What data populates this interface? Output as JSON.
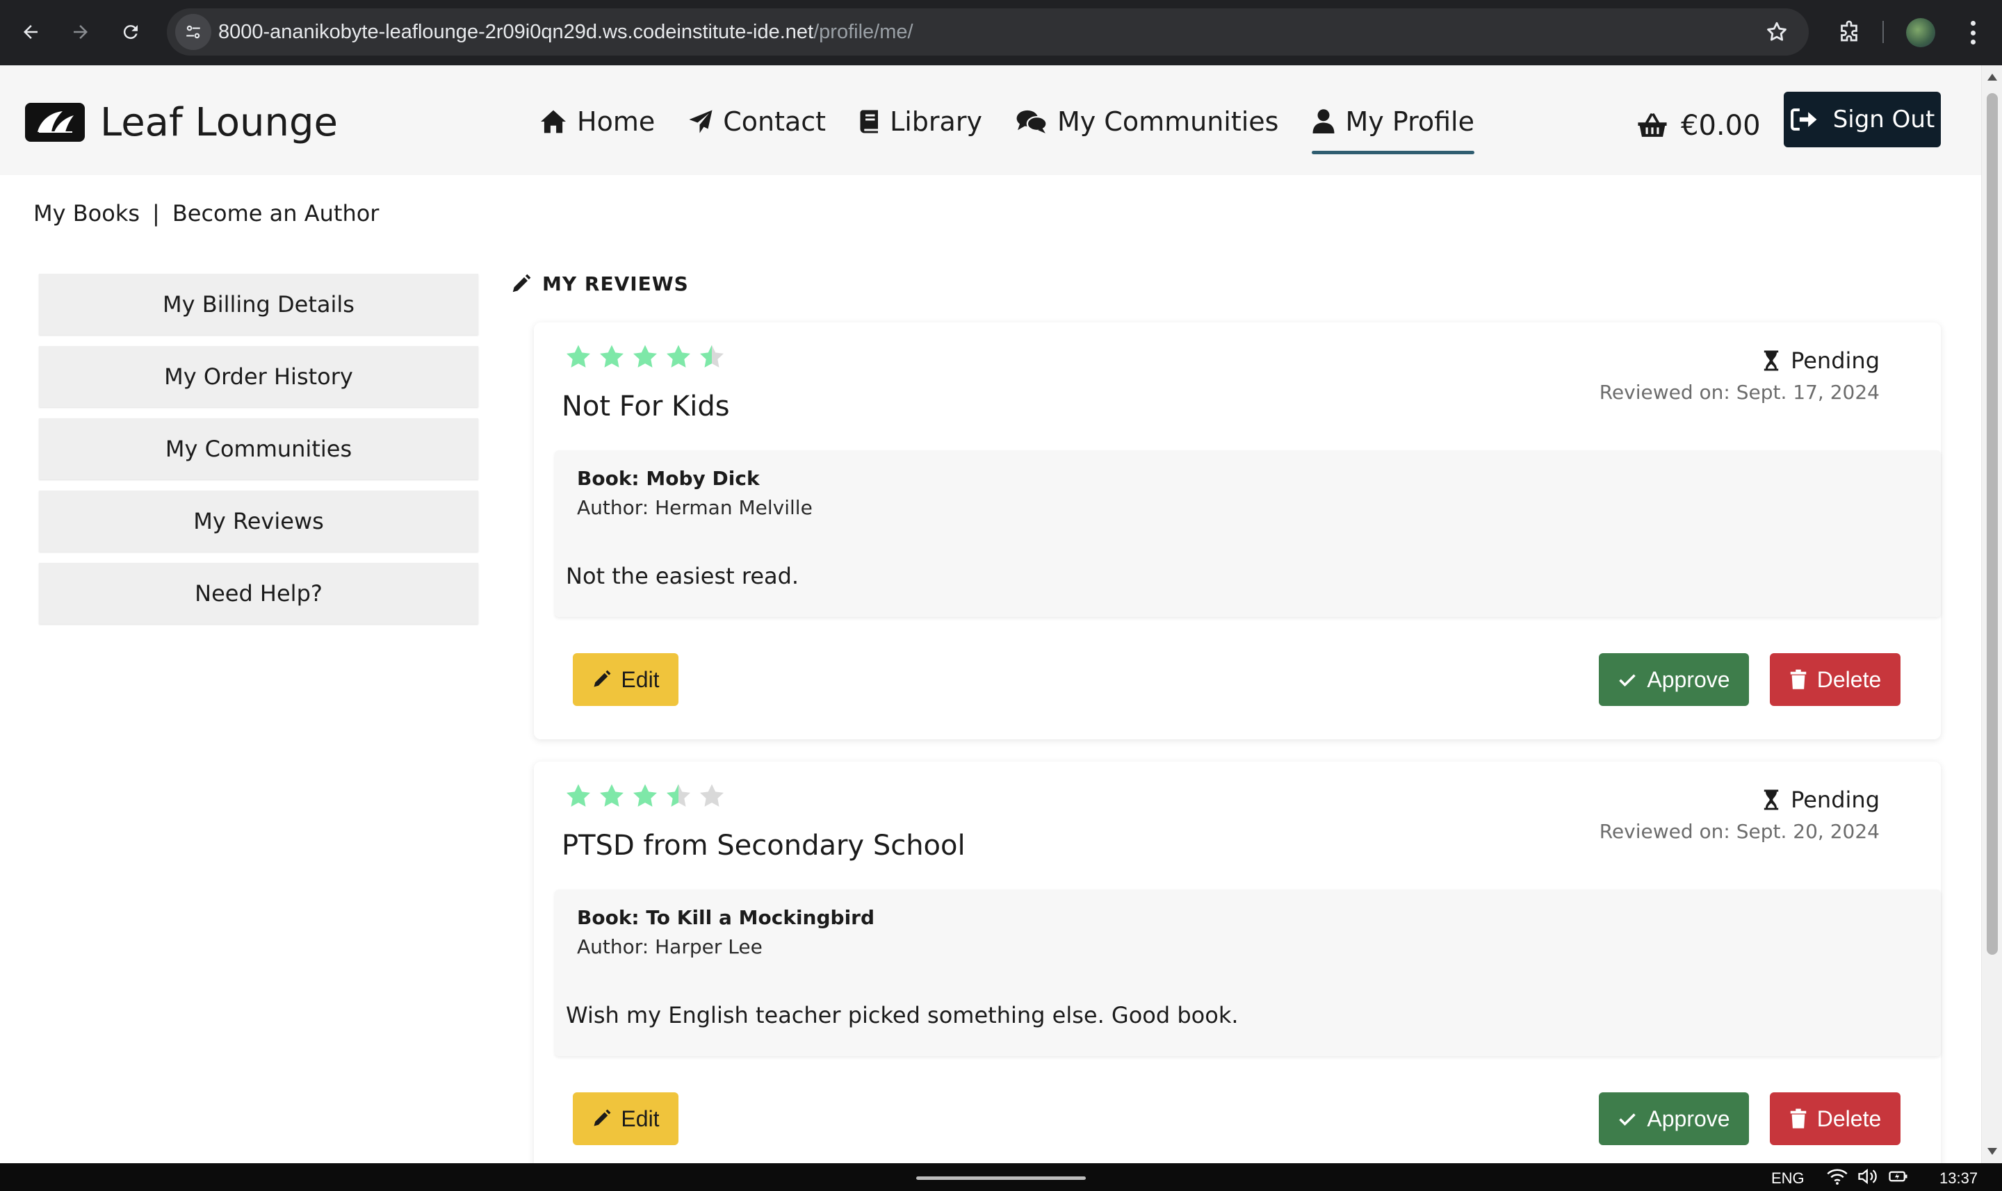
{
  "browser": {
    "url_host": "8000-ananikobyte-leaflounge-2r09i0qn29d.ws.codeinstitute-ide.net",
    "url_path": "/profile/me/"
  },
  "site": {
    "brand": "Leaf Lounge",
    "nav": [
      {
        "label": "Home",
        "icon": "home-icon"
      },
      {
        "label": "Contact",
        "icon": "paper-plane-icon"
      },
      {
        "label": "Library",
        "icon": "book-icon"
      },
      {
        "label": "My Communities",
        "icon": "comments-icon"
      },
      {
        "label": "My Profile",
        "icon": "user-icon",
        "active": true
      }
    ],
    "cart_total": "€0.00",
    "sign_out": "Sign Out"
  },
  "subnav": {
    "my_books": "My Books",
    "divider": "|",
    "become_author": "Become an Author"
  },
  "sidemenu": [
    "My Billing Details",
    "My Order History",
    "My Communities",
    "My Reviews",
    "Need Help?"
  ],
  "reviews_heading": "MY REVIEWS",
  "reviews": [
    {
      "rating": 4.5,
      "status": "Pending",
      "reviewed_on": "Reviewed on: Sept. 17, 2024",
      "title": "Not For Kids",
      "book": "Book: Moby Dick",
      "author": "Author: Herman Melville",
      "content": "Not the easiest read.",
      "edit": "Edit",
      "approve": "Approve",
      "delete": "Delete"
    },
    {
      "rating": 3.5,
      "status": "Pending",
      "reviewed_on": "Reviewed on: Sept. 20, 2024",
      "title": "PTSD from Secondary School",
      "book": "Book: To Kill a Mockingbird",
      "author": "Author: Harper Lee",
      "content": "Wish my English teacher picked something else. Good book.",
      "edit": "Edit",
      "approve": "Approve",
      "delete": "Delete"
    }
  ],
  "colors": {
    "star_filled": "#7ee8a8",
    "star_empty": "#d9d9d9",
    "edit_button": "#f0c43c",
    "approve_button": "#3e7d4b",
    "delete_button": "#c7363c",
    "sign_out_button": "#0f1e2a",
    "active_nav_underline": "#2f5d70"
  },
  "taskbar": {
    "lang": "ENG",
    "time": "13:37"
  }
}
